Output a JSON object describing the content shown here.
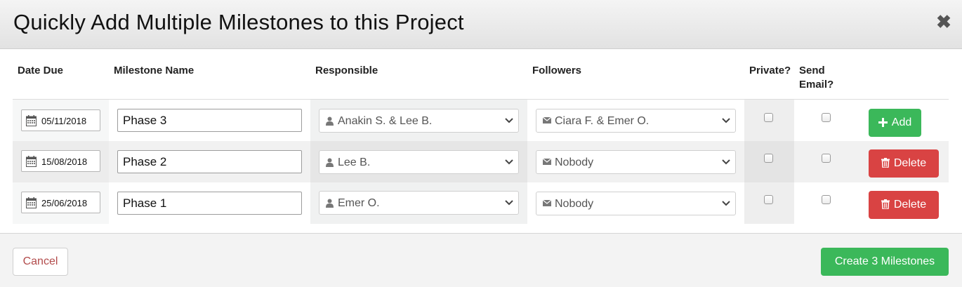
{
  "modal": {
    "title": "Quickly Add Multiple Milestones to this Project",
    "close_icon": "close-icon"
  },
  "columns": {
    "date_due": "Date Due",
    "milestone_name": "Milestone Name",
    "responsible": "Responsible",
    "followers": "Followers",
    "private": "Private?",
    "send_email_line1": "Send",
    "send_email_line2": "Email?"
  },
  "rows": [
    {
      "date": "05/11/2018",
      "name": "Phase 3",
      "responsible": "Anakin S. & Lee B.",
      "followers": "Ciara F. & Emer O.",
      "private": false,
      "send_email": false,
      "action": "Add"
    },
    {
      "date": "15/08/2018",
      "name": "Phase 2",
      "responsible": "Lee B.",
      "followers": "Nobody",
      "private": false,
      "send_email": false,
      "action": "Delete"
    },
    {
      "date": "25/06/2018",
      "name": "Phase 1",
      "responsible": "Emer O.",
      "followers": "Nobody",
      "private": false,
      "send_email": false,
      "action": "Delete"
    }
  ],
  "footer": {
    "cancel_label": "Cancel",
    "create_label": "Create 3 Milestones"
  },
  "colors": {
    "success": "#3bb85a",
    "danger": "#d94343",
    "cancel_text": "#b24b4b"
  }
}
